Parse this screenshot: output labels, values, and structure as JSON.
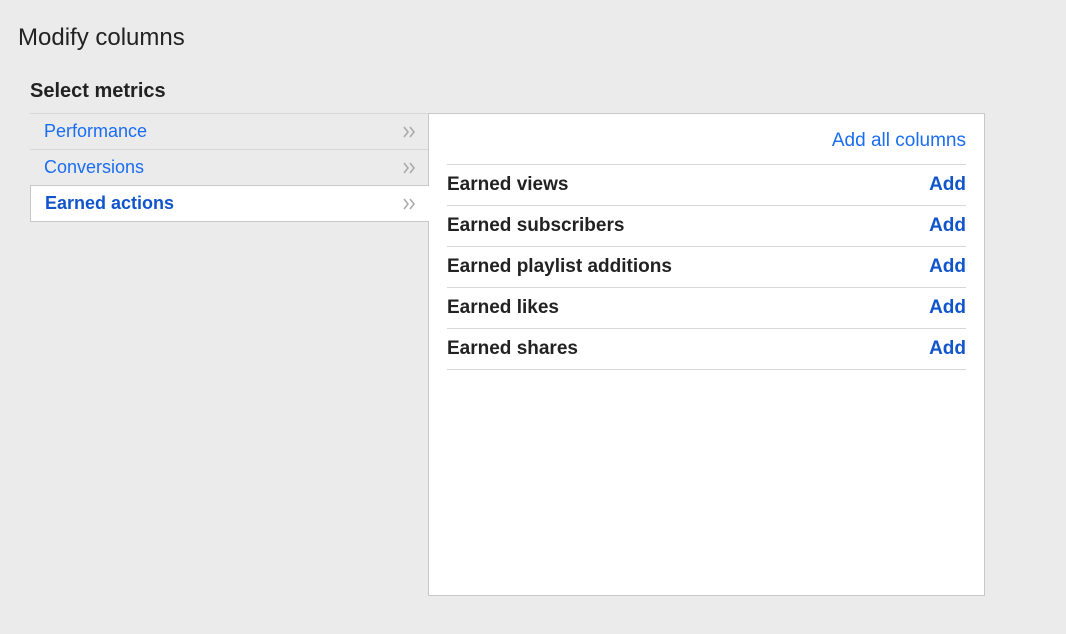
{
  "page_title": "Modify columns",
  "section_title": "Select metrics",
  "sidebar": {
    "items": [
      {
        "label": "Performance",
        "active": false
      },
      {
        "label": "Conversions",
        "active": false
      },
      {
        "label": "Earned actions",
        "active": true
      }
    ]
  },
  "panel": {
    "add_all_label": "Add all columns",
    "add_button_label": "Add",
    "metrics": [
      {
        "label": "Earned views"
      },
      {
        "label": "Earned subscribers"
      },
      {
        "label": "Earned playlist additions"
      },
      {
        "label": "Earned likes"
      },
      {
        "label": "Earned shares"
      }
    ]
  }
}
